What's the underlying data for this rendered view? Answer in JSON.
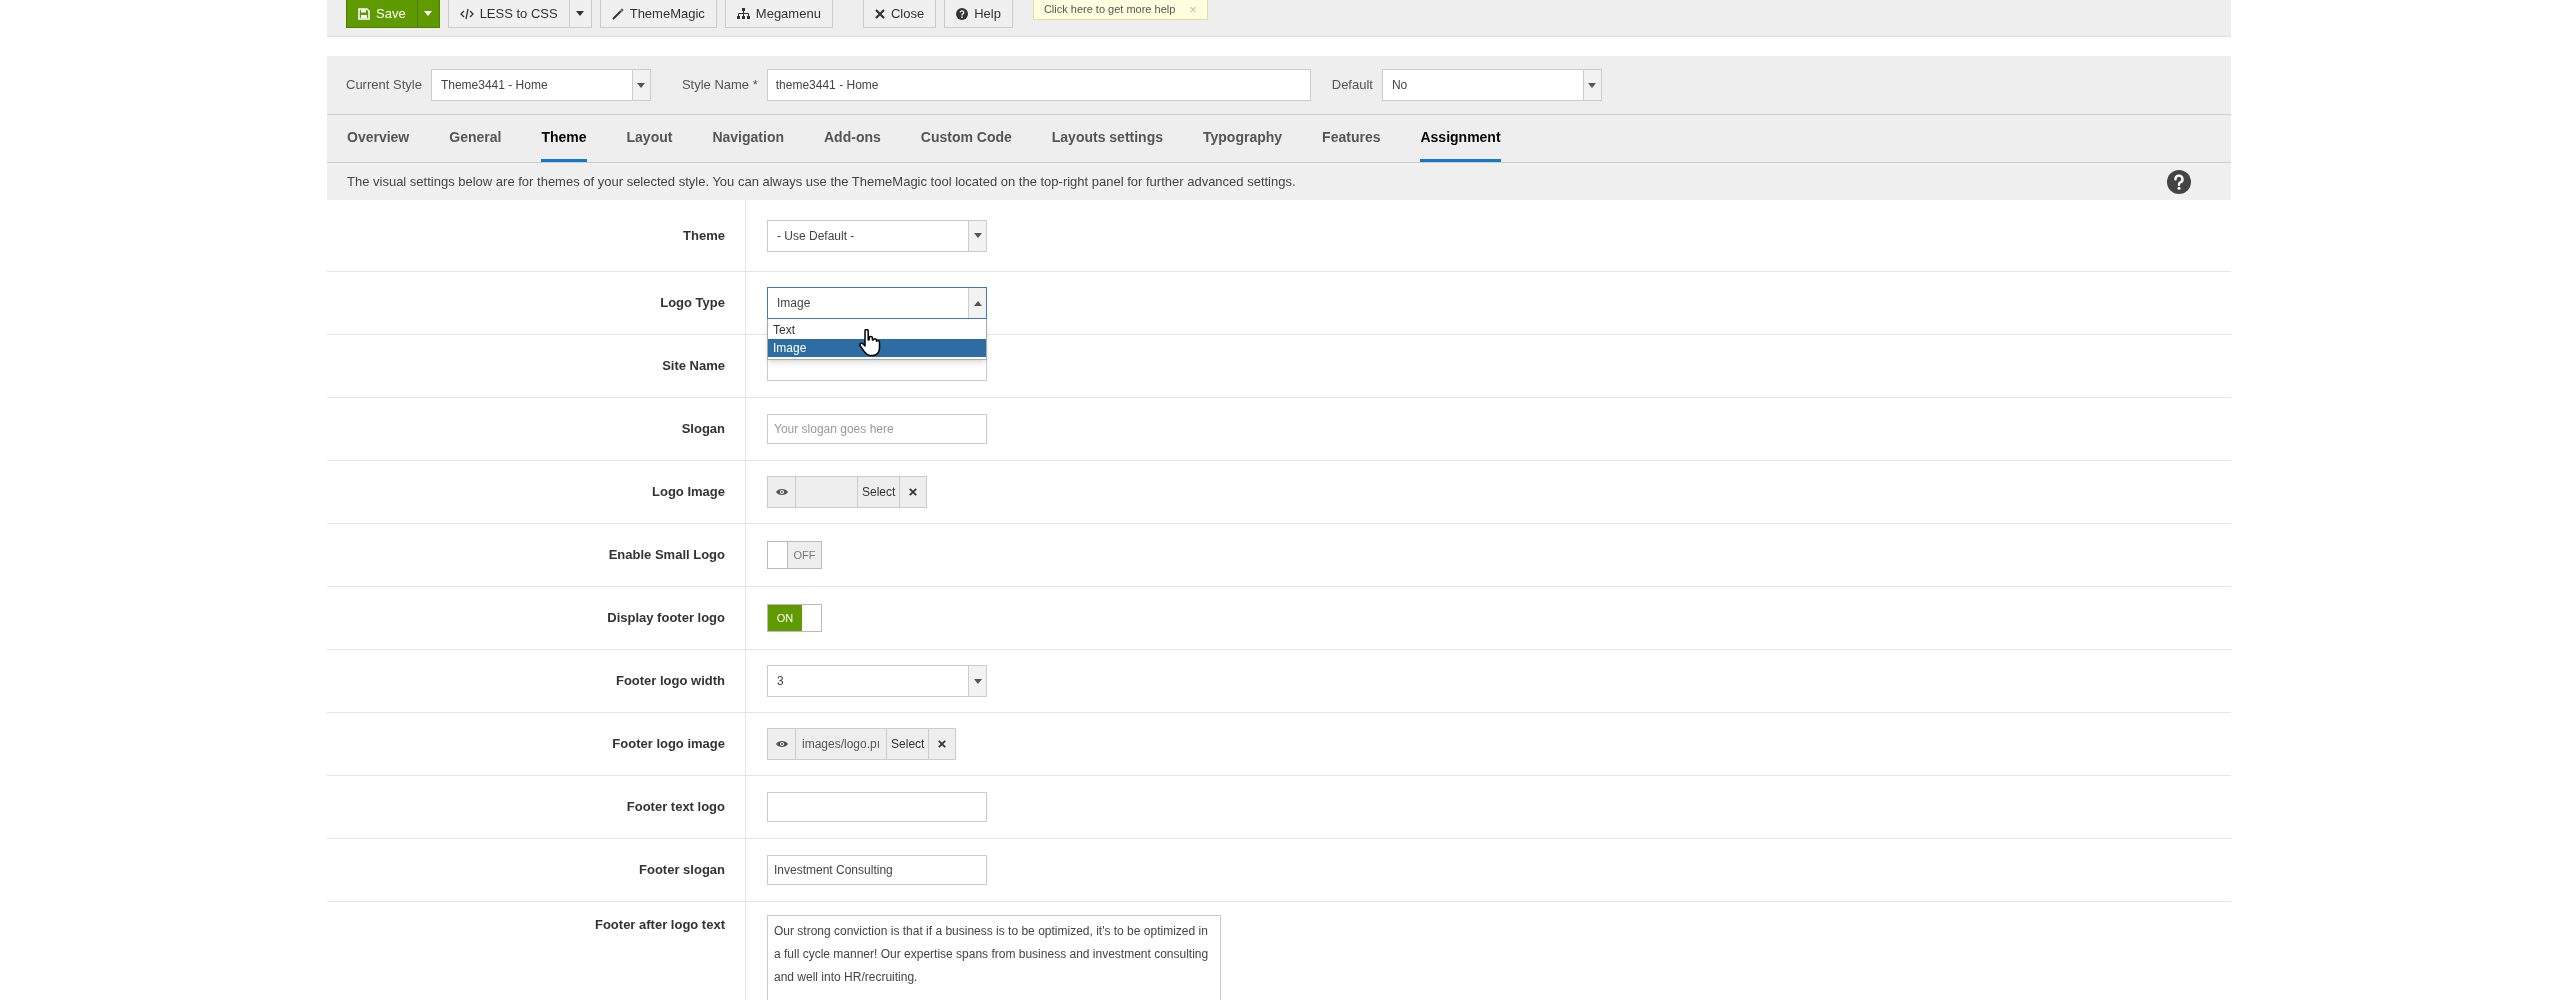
{
  "toolbar": {
    "buttons": [
      {
        "label": "Save",
        "kind": "primary",
        "caret": true
      },
      {
        "label": "LESS to CSS",
        "kind": "default",
        "caret": true
      },
      {
        "label": "ThemeMagic",
        "kind": "default",
        "caret": false
      },
      {
        "label": "Megamenu",
        "kind": "default",
        "caret": false
      },
      {
        "label": "Close",
        "kind": "default",
        "caret": false
      },
      {
        "label": "Help",
        "kind": "default",
        "caret": false
      }
    ],
    "tooltip": {
      "text": "Click here to get more help",
      "close": "×"
    }
  },
  "style_bar": {
    "current_style": {
      "label": "Current Style",
      "value": "Theme3441 - Home"
    },
    "style_name": {
      "label": "Style Name *",
      "value": "theme3441 - Home"
    },
    "default": {
      "label": "Default",
      "value": "No"
    }
  },
  "tabs": [
    {
      "label": "Overview",
      "selected": false
    },
    {
      "label": "General",
      "selected": false
    },
    {
      "label": "Theme",
      "selected": true
    },
    {
      "label": "Layout",
      "selected": false
    },
    {
      "label": "Navigation",
      "selected": false
    },
    {
      "label": "Add-ons",
      "selected": false
    },
    {
      "label": "Custom Code",
      "selected": false
    },
    {
      "label": "Layouts settings",
      "selected": false
    },
    {
      "label": "Typography",
      "selected": false
    },
    {
      "label": "Features",
      "selected": false
    },
    {
      "label": "Assignment",
      "selected": true
    }
  ],
  "info": "The visual settings below are for themes of your selected style. You can always use the ThemeMagic tool located on the top-right panel for further advanced settings.",
  "fields": [
    {
      "label": "Theme",
      "kind": "select",
      "value": "- Use Default -"
    },
    {
      "label": "Logo Type",
      "kind": "select",
      "value": "Image",
      "expanded": true,
      "options": [
        {
          "label": "Text",
          "selected": false
        },
        {
          "label": "Image",
          "selected": true
        }
      ]
    },
    {
      "label": "Site Name",
      "kind": "text"
    },
    {
      "label": "Slogan",
      "kind": "text",
      "placeholder": "Your slogan goes here"
    },
    {
      "label": "Logo Image",
      "kind": "media",
      "select": "Select"
    },
    {
      "label": "Enable Small Logo",
      "kind": "toggle",
      "on": false,
      "state_label": "OFF"
    },
    {
      "label": "Display footer logo",
      "kind": "toggle",
      "on": true,
      "state_label": "ON"
    },
    {
      "label": "Footer logo width",
      "kind": "select",
      "value": "3"
    },
    {
      "label": "Footer logo image",
      "kind": "media",
      "value": "images/logo.pı",
      "select": "Select"
    },
    {
      "label": "Footer text logo",
      "kind": "text"
    },
    {
      "label": "Footer slogan",
      "kind": "text",
      "value": "Investment Consulting"
    },
    {
      "label": "Footer after logo text",
      "kind": "textarea",
      "value": "Our strong conviction is that if a business is to be optimized, it's to be optimized in a full cycle manner! Our expertise spans from business and investment consulting and well into HR/recruiting."
    }
  ]
}
